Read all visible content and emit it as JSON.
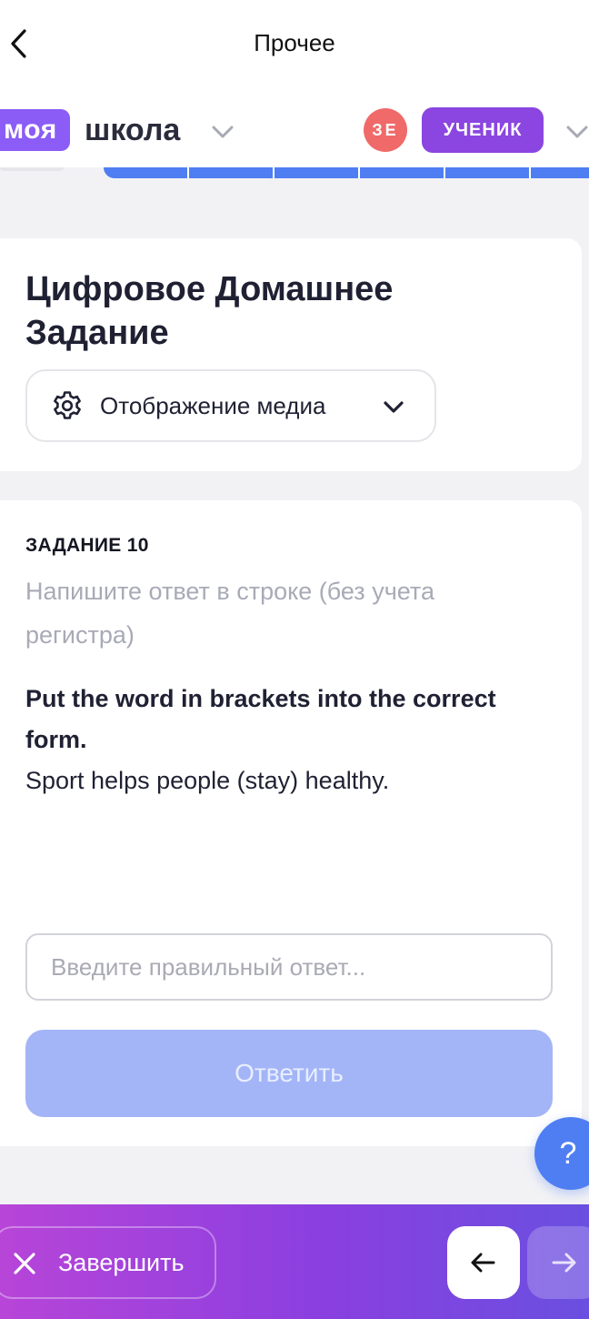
{
  "topbar": {
    "title": "Прочее"
  },
  "header": {
    "logo_box_text": "моя",
    "logo_text": "школа",
    "avatar_initials": "ЗЕ",
    "role_label": "УЧЕНИК",
    "colors": {
      "logo_purple": "#8b5cf6",
      "avatar_red": "#f06a6a",
      "role_purple": "#8b45e0"
    }
  },
  "tabstrip": {
    "segments": 6,
    "color": "#4f7ef3"
  },
  "homework": {
    "title": "Цифровое Домашнее Задание",
    "media_button_label": "Отображение медиа",
    "media_icon": "gear-icon"
  },
  "task": {
    "label": "ЗАДАНИЕ 10",
    "hint": "Напишите ответ в строке (без учета регистра)",
    "question_bold": "Put the word in brackets into the correct form.",
    "question": "Sport helps people (stay) healthy.",
    "input_placeholder": "Введите правильный ответ...",
    "input_value": "",
    "submit_label": "Ответить"
  },
  "help": {
    "label": "?"
  },
  "bottombar": {
    "finish_label": "Завершить",
    "prev_icon": "arrow-left-icon",
    "next_icon": "arrow-right-icon"
  }
}
